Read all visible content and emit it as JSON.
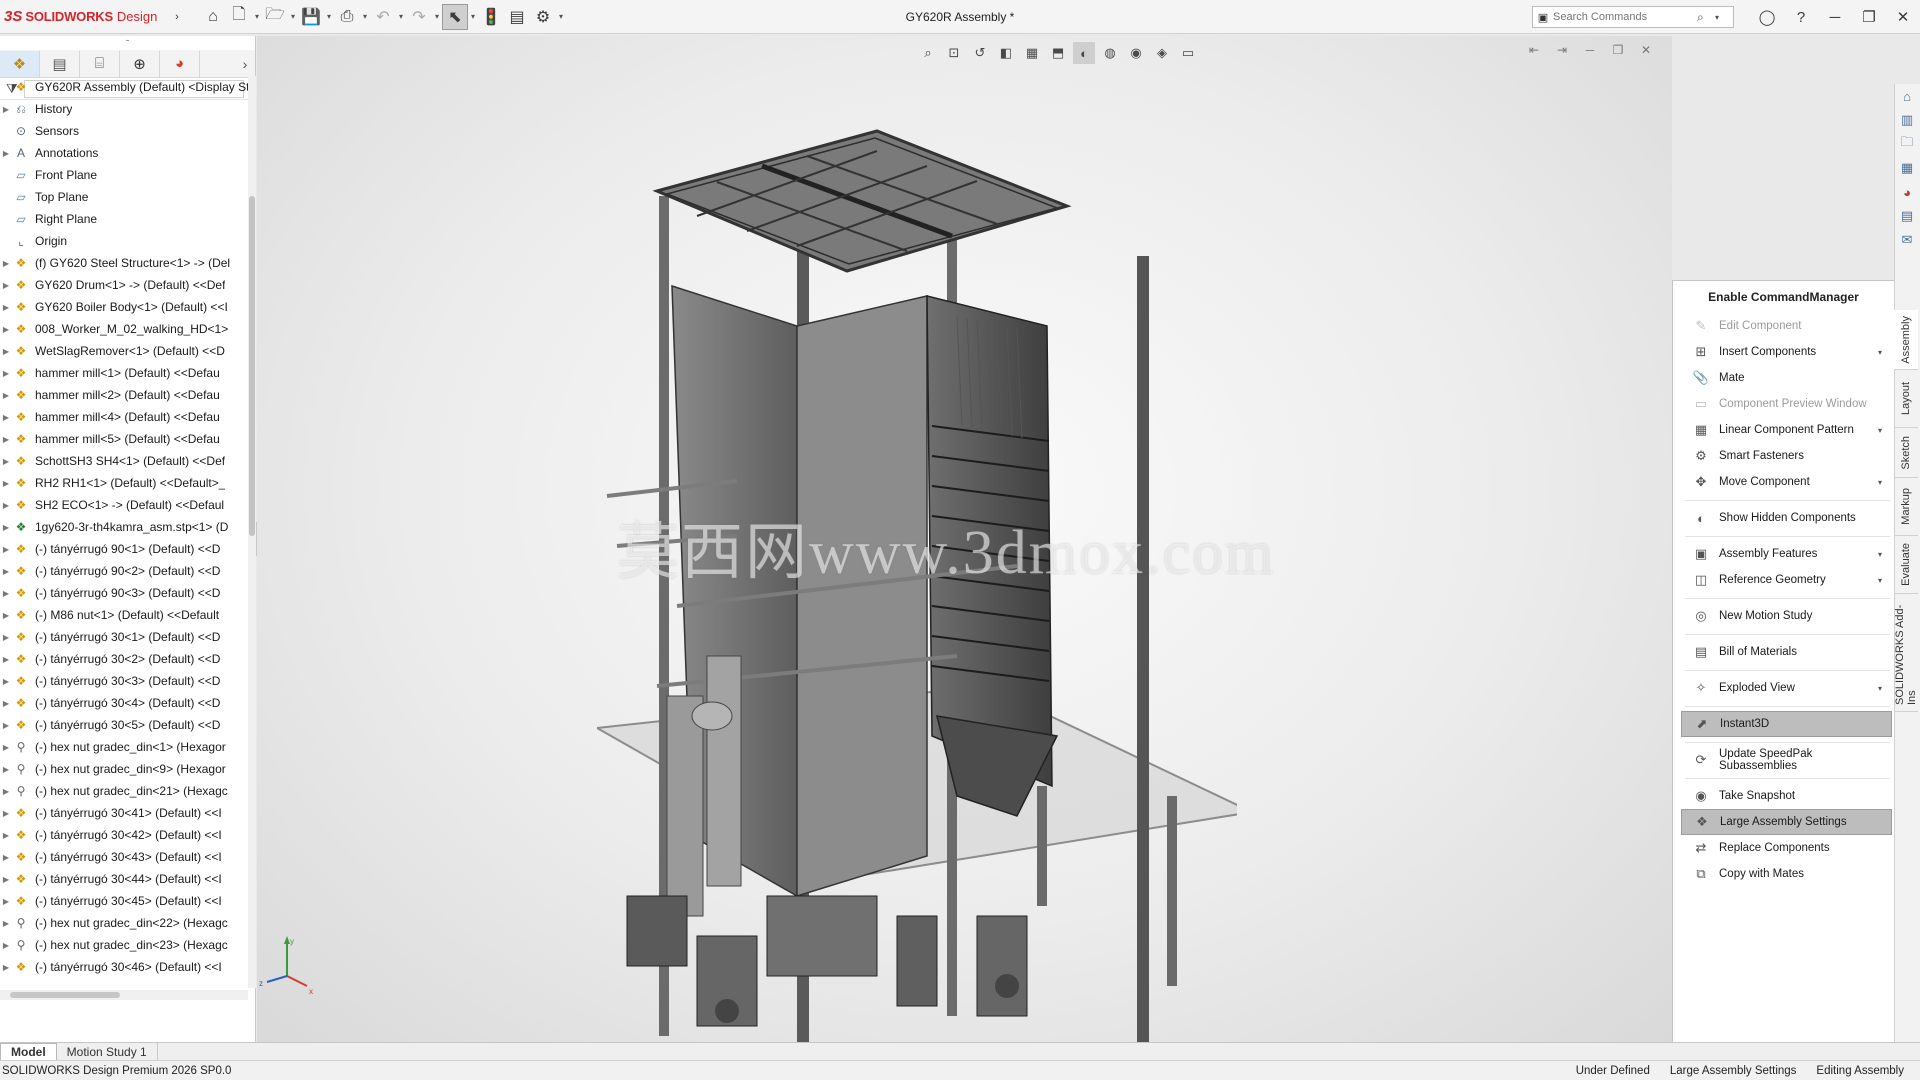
{
  "app": {
    "brand_prefix": "3S",
    "brand": "SOLIDWORKS",
    "brand_suffix": "Design",
    "window_title": "GY620R Assembly *"
  },
  "toolbar": {
    "icons": [
      "home-icon",
      "new-icon",
      "open-icon",
      "save-icon",
      "print-icon",
      "undo-icon",
      "redo-icon",
      "select-icon",
      "rebuild-icon",
      "file-properties-icon",
      "options-icon"
    ]
  },
  "search": {
    "placeholder": "Search Commands"
  },
  "tree": {
    "rows": [
      {
        "label": "GY620R Assembly (Default) <Display Sta",
        "icon": "assembly-icon",
        "expand": false,
        "root": true
      },
      {
        "label": "History",
        "icon": "history-icon",
        "expand": true
      },
      {
        "label": "Sensors",
        "icon": "sensors-icon",
        "expand": false
      },
      {
        "label": "Annotations",
        "icon": "annotations-icon",
        "expand": true
      },
      {
        "label": "Front Plane",
        "icon": "plane-icon",
        "expand": false
      },
      {
        "label": "Top Plane",
        "icon": "plane-icon",
        "expand": false
      },
      {
        "label": "Right Plane",
        "icon": "plane-icon",
        "expand": false
      },
      {
        "label": "Origin",
        "icon": "origin-icon",
        "expand": false
      },
      {
        "label": "(f) GY620 Steel Structure<1> -> (Del",
        "icon": "assembly-icon",
        "expand": true
      },
      {
        "label": "GY620 Drum<1> -> (Default) <<Def",
        "icon": "assembly-icon",
        "expand": true
      },
      {
        "label": "GY620 Boiler Body<1> (Default) <<I",
        "icon": "assembly-icon",
        "expand": true
      },
      {
        "label": "008_Worker_M_02_walking_HD<1>",
        "icon": "assembly-icon",
        "expand": true
      },
      {
        "label": "WetSlagRemover<1> (Default) <<D",
        "icon": "assembly-icon",
        "expand": true
      },
      {
        "label": "hammer mill<1> (Default) <<Defau",
        "icon": "assembly-icon",
        "expand": true
      },
      {
        "label": "hammer mill<2> (Default) <<Defau",
        "icon": "assembly-icon",
        "expand": true
      },
      {
        "label": "hammer mill<4> (Default) <<Defau",
        "icon": "assembly-icon",
        "expand": true
      },
      {
        "label": "hammer mill<5> (Default) <<Defau",
        "icon": "assembly-icon",
        "expand": true
      },
      {
        "label": "SchottSH3 SH4<1> (Default) <<Def",
        "icon": "assembly-icon",
        "expand": true
      },
      {
        "label": "RH2 RH1<1> (Default) <<Default>_",
        "icon": "assembly-icon",
        "expand": true
      },
      {
        "label": "SH2 ECO<1> -> (Default) <<Defaul",
        "icon": "assembly-icon",
        "expand": true
      },
      {
        "label": "1gy620-3r-th4kamra_asm.stp<1> (D",
        "icon": "speedpak-icon",
        "expand": true
      },
      {
        "label": "(-) tányérrugó 90<1> (Default) <<D",
        "icon": "assembly-icon",
        "expand": true
      },
      {
        "label": "(-) tányérrugó 90<2> (Default) <<D",
        "icon": "assembly-icon",
        "expand": true
      },
      {
        "label": "(-) tányérrugó 90<3> (Default) <<D",
        "icon": "assembly-icon",
        "expand": true
      },
      {
        "label": "(-) M86 nut<1> (Default) <<Default",
        "icon": "assembly-icon",
        "expand": true
      },
      {
        "label": "(-) tányérrugó 30<1> (Default) <<D",
        "icon": "assembly-icon",
        "expand": true
      },
      {
        "label": "(-) tányérrugó 30<2> (Default) <<D",
        "icon": "assembly-icon",
        "expand": true
      },
      {
        "label": "(-) tányérrugó 30<3> (Default) <<D",
        "icon": "assembly-icon",
        "expand": true
      },
      {
        "label": "(-) tányérrugó 30<4> (Default) <<D",
        "icon": "assembly-icon",
        "expand": true
      },
      {
        "label": "(-) tányérrugó 30<5> (Default) <<D",
        "icon": "assembly-icon",
        "expand": true
      },
      {
        "label": "(-) hex nut gradec_din<1> (Hexagor",
        "icon": "hardware-icon",
        "expand": true
      },
      {
        "label": "(-) hex nut gradec_din<9> (Hexagor",
        "icon": "hardware-icon",
        "expand": true
      },
      {
        "label": "(-) hex nut gradec_din<21> (Hexagc",
        "icon": "hardware-icon",
        "expand": true
      },
      {
        "label": "(-) tányérrugó 30<41> (Default) <<I",
        "icon": "assembly-icon",
        "expand": true
      },
      {
        "label": "(-) tányérrugó 30<42> (Default) <<I",
        "icon": "assembly-icon",
        "expand": true
      },
      {
        "label": "(-) tányérrugó 30<43> (Default) <<I",
        "icon": "assembly-icon",
        "expand": true
      },
      {
        "label": "(-) tányérrugó 30<44> (Default) <<I",
        "icon": "assembly-icon",
        "expand": true
      },
      {
        "label": "(-) tányérrugó 30<45> (Default) <<I",
        "icon": "assembly-icon",
        "expand": true
      },
      {
        "label": "(-) hex nut gradec_din<22> (Hexagc",
        "icon": "hardware-icon",
        "expand": true
      },
      {
        "label": "(-) hex nut gradec_din<23> (Hexagc",
        "icon": "hardware-icon",
        "expand": true
      },
      {
        "label": "(-) tányérrugó 30<46> (Default) <<I",
        "icon": "assembly-icon",
        "expand": true
      }
    ]
  },
  "viewport": {
    "watermark": "莫西网www.3dmox.com"
  },
  "command_manager": {
    "title": "Enable CommandManager",
    "items": [
      {
        "label": "Edit Component",
        "icon": "edit-component-icon",
        "disabled": true,
        "dropdown": false,
        "highlight": false,
        "sep_after": false
      },
      {
        "label": "Insert Components",
        "icon": "insert-components-icon",
        "disabled": false,
        "dropdown": true,
        "highlight": false,
        "sep_after": false
      },
      {
        "label": "Mate",
        "icon": "mate-icon",
        "disabled": false,
        "dropdown": false,
        "highlight": false,
        "sep_after": false
      },
      {
        "label": "Component Preview Window",
        "icon": "preview-window-icon",
        "disabled": true,
        "dropdown": false,
        "highlight": false,
        "sep_after": false
      },
      {
        "label": "Linear Component Pattern",
        "icon": "linear-pattern-icon",
        "disabled": false,
        "dropdown": true,
        "highlight": false,
        "sep_after": false
      },
      {
        "label": "Smart Fasteners",
        "icon": "smart-fasteners-icon",
        "disabled": false,
        "dropdown": false,
        "highlight": false,
        "sep_after": false
      },
      {
        "label": "Move Component",
        "icon": "move-component-icon",
        "disabled": false,
        "dropdown": true,
        "highlight": false,
        "sep_after": true
      },
      {
        "label": "Show Hidden Components",
        "icon": "show-hidden-icon",
        "disabled": false,
        "dropdown": false,
        "highlight": false,
        "sep_after": true
      },
      {
        "label": "Assembly Features",
        "icon": "assembly-features-icon",
        "disabled": false,
        "dropdown": true,
        "highlight": false,
        "sep_after": false
      },
      {
        "label": "Reference Geometry",
        "icon": "reference-geometry-icon",
        "disabled": false,
        "dropdown": true,
        "highlight": false,
        "sep_after": true
      },
      {
        "label": "New Motion Study",
        "icon": "motion-study-icon",
        "disabled": false,
        "dropdown": false,
        "highlight": false,
        "sep_after": true
      },
      {
        "label": "Bill of Materials",
        "icon": "bom-icon",
        "disabled": false,
        "dropdown": false,
        "highlight": false,
        "sep_after": true
      },
      {
        "label": "Exploded View",
        "icon": "exploded-view-icon",
        "disabled": false,
        "dropdown": true,
        "highlight": false,
        "sep_after": true
      },
      {
        "label": "Instant3D",
        "icon": "instant3d-icon",
        "disabled": false,
        "dropdown": false,
        "highlight": true,
        "sep_after": true
      },
      {
        "label": "Update SpeedPak Subassemblies",
        "icon": "speedpak-update-icon",
        "disabled": false,
        "dropdown": false,
        "highlight": false,
        "sep_after": true
      },
      {
        "label": "Take Snapshot",
        "icon": "camera-icon",
        "disabled": false,
        "dropdown": false,
        "highlight": false,
        "sep_after": false
      },
      {
        "label": "Large Assembly Settings",
        "icon": "large-assembly-icon",
        "disabled": false,
        "dropdown": false,
        "highlight": true,
        "sep_after": false
      },
      {
        "label": "Replace Components",
        "icon": "replace-components-icon",
        "disabled": false,
        "dropdown": false,
        "highlight": false,
        "sep_after": false
      },
      {
        "label": "Copy with Mates",
        "icon": "copy-mates-icon",
        "disabled": false,
        "dropdown": false,
        "highlight": false,
        "sep_after": false
      }
    ],
    "tabs": [
      "Assembly",
      "Layout",
      "Sketch",
      "Markup",
      "Evaluate",
      "SOLIDWORKS Add-Ins"
    ]
  },
  "bottom_tabs": [
    "Model",
    "Motion Study 1"
  ],
  "status": {
    "left": "SOLIDWORKS Design Premium 2026 SP0.0",
    "right": [
      "Under Defined",
      "Large Assembly Settings",
      "Editing Assembly"
    ]
  },
  "colors": {
    "brand": "#d6242a",
    "highlight": "#bdbdbd",
    "selected_tab": "#dce9f7"
  }
}
